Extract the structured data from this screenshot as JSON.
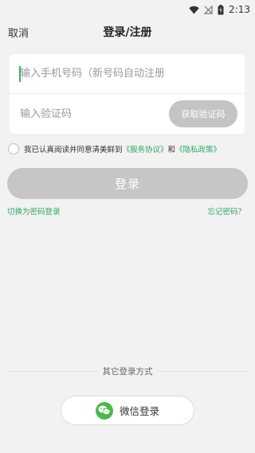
{
  "status_bar": {
    "time": "2:13"
  },
  "nav": {
    "cancel_label": "取消",
    "title": "登录/注册"
  },
  "form": {
    "phone_placeholder": "输入手机号码（新号码自动注册）",
    "code_placeholder": "输入验证码",
    "get_code_label": "获取验证码"
  },
  "agreement": {
    "prefix": "我已认真阅读并同意清美鲜到",
    "service_link": "《服务协议》",
    "and_text": "和",
    "privacy_link": "《隐私政策》"
  },
  "login_label": "登录",
  "links": {
    "switch_label": "切换为密码登录",
    "forgot_label": "忘记密码？"
  },
  "other": {
    "label": "其它登录方式",
    "wechat_label": "微信登录"
  },
  "colors": {
    "accent": "#2fa86a",
    "wechat": "#4bb84b",
    "disabled": "#c6c6c6"
  }
}
